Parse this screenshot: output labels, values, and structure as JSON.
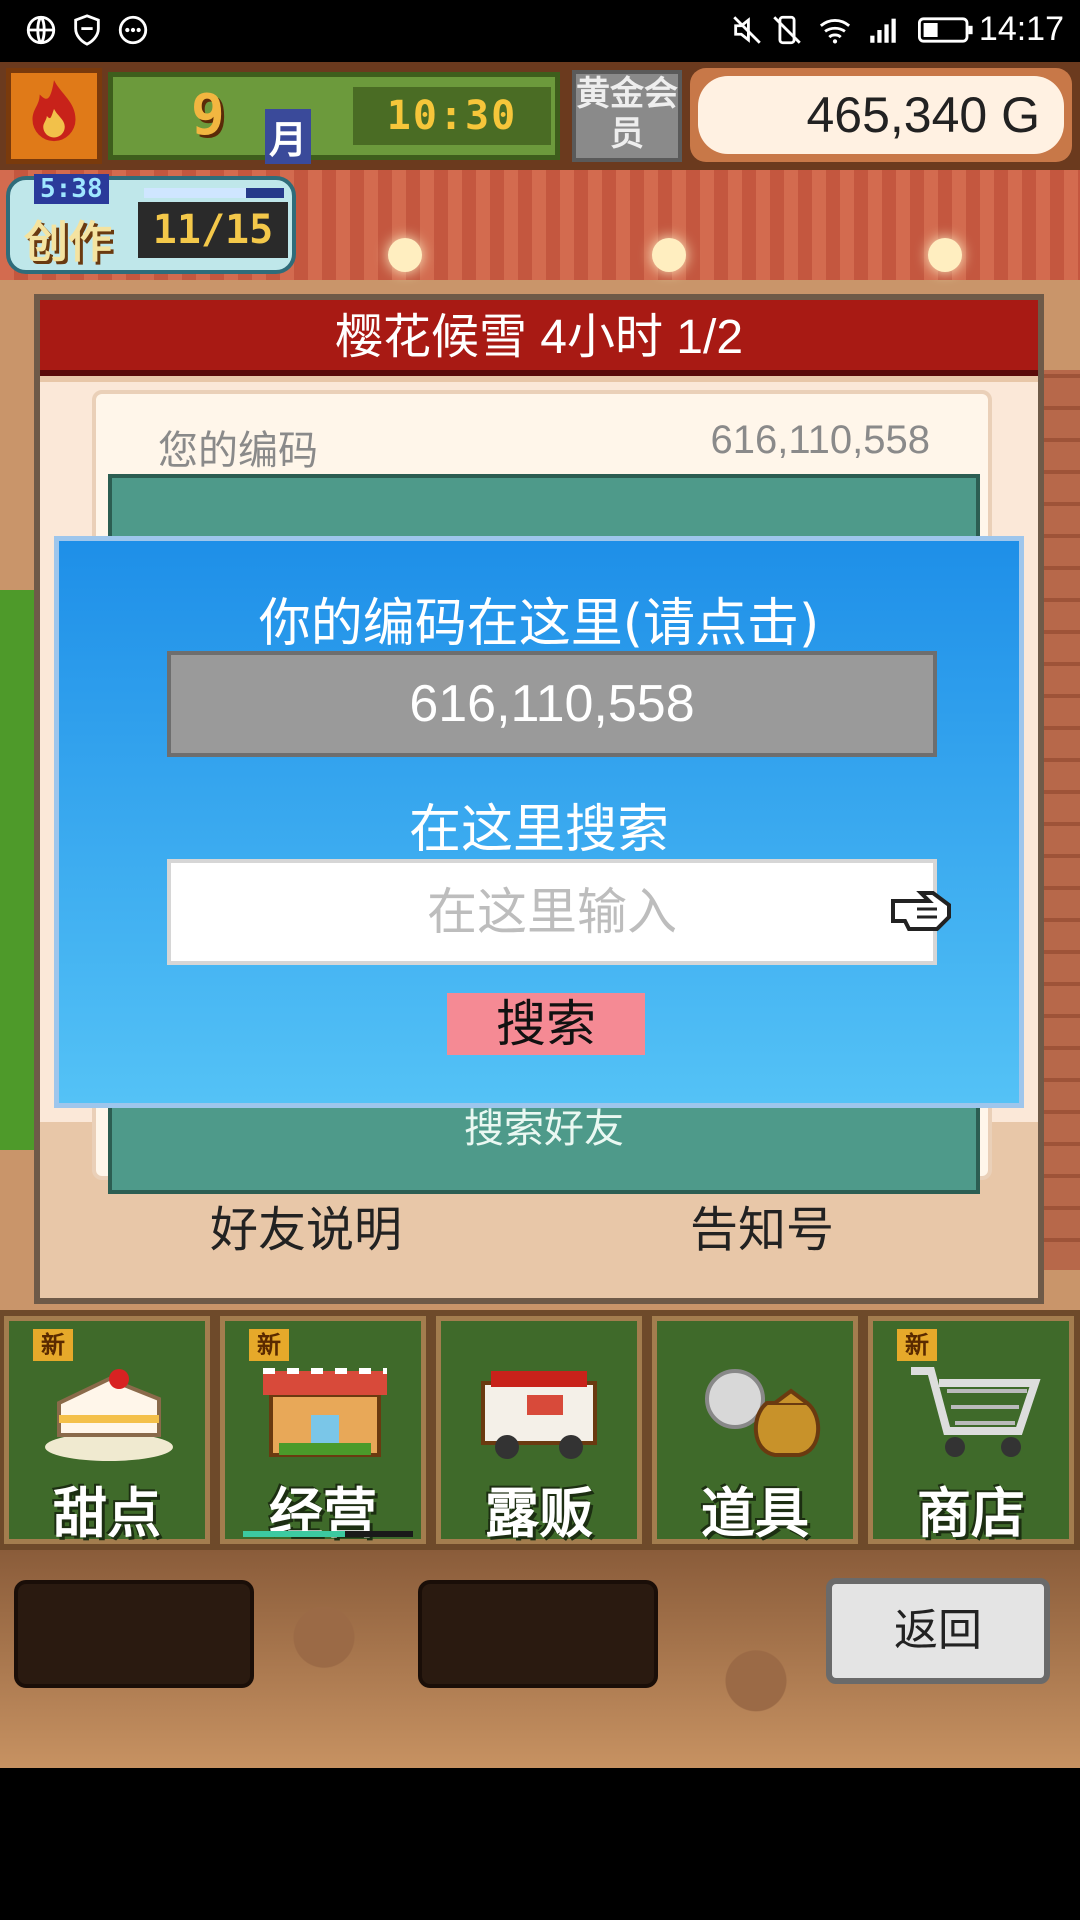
{
  "status_bar": {
    "time": "14:17"
  },
  "hud": {
    "month_number": "9",
    "month_label": "月",
    "clock": "10:30",
    "gold_member_label": "黄金会员",
    "money": "465,340 G"
  },
  "create_badge": {
    "timer": "5:38",
    "label": "创作",
    "count": "11/15",
    "progress": 0.73
  },
  "panel": {
    "title": "樱花候雪  4小时 1/2",
    "code_label": "您的编码",
    "code_value": "616,110,558",
    "teal_label": "搜索好友",
    "footer_left": "好友说明",
    "footer_right": "告知号"
  },
  "popup": {
    "title": "你的编码在这里(请点击)",
    "code": "616,110,558",
    "search_label": "在这里搜索",
    "input_placeholder": "在这里输入",
    "input_value": "",
    "search_button": "搜索"
  },
  "menu": {
    "new_badge": "新",
    "items": [
      {
        "label": "甜点"
      },
      {
        "label": "经营"
      },
      {
        "label": "露贩"
      },
      {
        "label": "道具"
      },
      {
        "label": "商店"
      }
    ],
    "active_progress": 0.6
  },
  "tray": {
    "back_button": "返回"
  },
  "colors": {
    "popup_top": "#1e8fe8",
    "popup_bottom": "#54c2f6",
    "title_red": "#a81a14",
    "search_button": "#f58a94"
  }
}
